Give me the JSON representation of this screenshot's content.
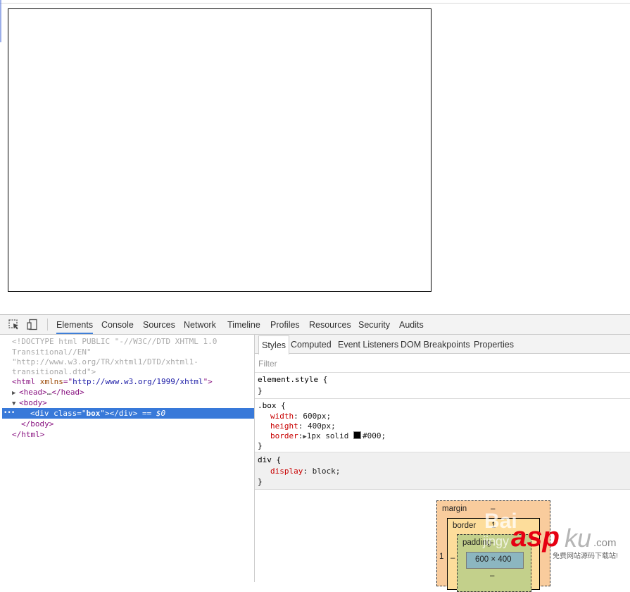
{
  "devtools": {
    "tabs": [
      "Elements",
      "Console",
      "Sources",
      "Network",
      "Timeline",
      "Profiles",
      "Resources",
      "Security",
      "Audits"
    ],
    "active_tab": "Elements",
    "icons": {
      "inspect": "inspect-element-icon",
      "device": "device-mode-icon"
    }
  },
  "elements": {
    "doctype_1": "<!DOCTYPE html PUBLIC \"-//W3C//DTD XHTML 1.0",
    "doctype_2": "Transitional//EN\"",
    "doctype_3": "\"http://www.w3.org/TR/xhtml1/DTD/xhtml1-",
    "doctype_4": "transitional.dtd\">",
    "html_open_tag": "<html",
    "html_attr_name": "xmlns",
    "html_attr_eq": "=\"",
    "html_attr_value": "http://www.w3.org/1999/xhtml",
    "html_close": "\">",
    "head_tag": "<head>",
    "head_ellipsis": "…",
    "head_close": "</head>",
    "body_tag": "<body>",
    "div_open": "<div",
    "div_attr_name": "class",
    "div_attr_eq": "=\"",
    "div_attr_value": "box",
    "div_close": "\"></div>",
    "div_dollar": "== $0",
    "body_close": "</body>",
    "html_close_tag": "</html>",
    "selected_marker": "•••"
  },
  "styles": {
    "tabs": [
      "Styles",
      "Computed",
      "Event Listeners",
      "DOM Breakpoints",
      "Properties"
    ],
    "active_tab": "Styles",
    "filter_placeholder": "Filter",
    "element_style_selector": "element.style {",
    "element_style_close": "}",
    "box_selector": ".box {",
    "box_props": [
      {
        "name": "width",
        "value": "600px;"
      },
      {
        "name": "height",
        "value": "400px;"
      },
      {
        "name": "border",
        "value": "1px solid ",
        "color": "#000;"
      }
    ],
    "box_close": "}",
    "div_selector": "div {",
    "div_prop_name": "display",
    "div_prop_value": "block;",
    "div_close": "}"
  },
  "box_model": {
    "margin_label": "margin",
    "margin_value": "–",
    "border_label": "border",
    "border_value": "1",
    "border_left": "1",
    "padding_label": "padding",
    "padding_value": "–",
    "padding_left": "–",
    "padding_bottom": "–",
    "content_size": "600 × 400"
  },
  "watermark": {
    "baidu": "Bai",
    "jingyan": "jingy",
    "asp": "asp",
    "ku": "ku",
    "com": ".com",
    "tagline": "免费网站源码下载站!"
  }
}
